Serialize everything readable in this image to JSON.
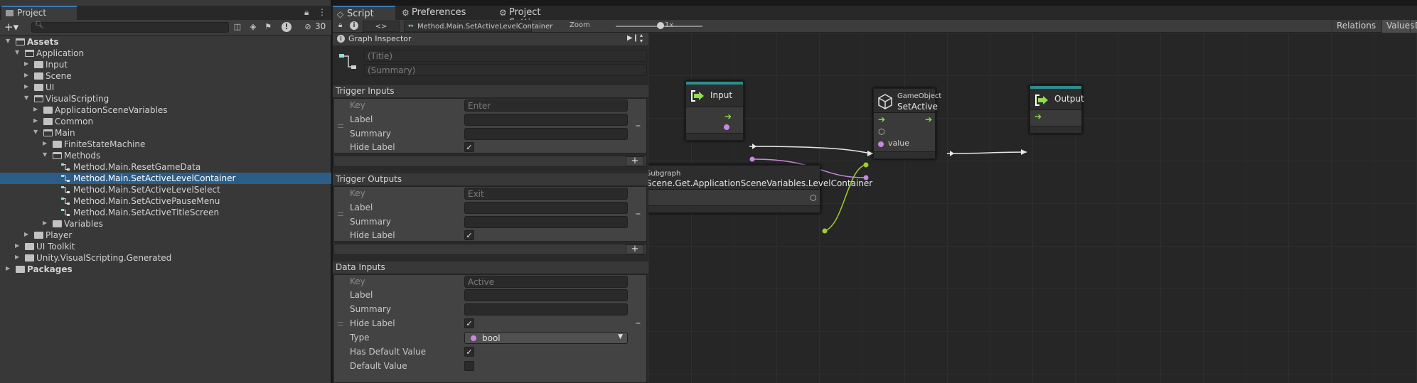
{
  "project": {
    "tab_label": "Project",
    "hidden_count": "30",
    "search": {
      "placeholder": ""
    },
    "tree": [
      {
        "label": "Assets",
        "bold": true
      },
      {
        "label": "Application"
      },
      {
        "label": "Input"
      },
      {
        "label": "Scene"
      },
      {
        "label": "UI"
      },
      {
        "label": "VisualScripting"
      },
      {
        "label": "ApplicationSceneVariables"
      },
      {
        "label": "Common"
      },
      {
        "label": "Main"
      },
      {
        "label": "FiniteStateMachine"
      },
      {
        "label": "Methods"
      },
      {
        "label": "Method.Main.ResetGameData"
      },
      {
        "label": "Method.Main.SetActiveLevelContainer",
        "selected": true
      },
      {
        "label": "Method.Main.SetActiveLevelSelect"
      },
      {
        "label": "Method.Main.SetActivePauseMenu"
      },
      {
        "label": "Method.Main.SetActiveTitleScreen"
      },
      {
        "label": "Variables"
      },
      {
        "label": "Player"
      },
      {
        "label": "UI Toolkit"
      },
      {
        "label": "Unity.VisualScripting.Generated"
      },
      {
        "label": "Packages",
        "bold": true
      }
    ]
  },
  "graph": {
    "tabs": [
      "Script Graph",
      "Preferences",
      "Project Settings"
    ],
    "toolbar": {
      "breadcrumb": "Method.Main.SetActiveLevelContainer",
      "zoom_label": "Zoom",
      "zoom_value": "1x",
      "zoom_level": 0.5,
      "right_tabs": [
        "Relations",
        "Values",
        "D"
      ]
    }
  },
  "inspector": {
    "title": "Graph Inspector",
    "title_placeholder": "(Title)",
    "summary_placeholder": "(Summary)",
    "trigger_inputs": {
      "header": "Trigger Inputs",
      "key_label": "Key",
      "key_value": "Enter",
      "label_label": "Label",
      "summary_label": "Summary",
      "hide_label": "Hide Label",
      "hide_checked": true
    },
    "trigger_outputs": {
      "header": "Trigger Outputs",
      "key_label": "Key",
      "key_value": "Exit",
      "label_label": "Label",
      "summary_label": "Summary",
      "hide_label": "Hide Label",
      "hide_checked": true
    },
    "data_inputs": {
      "header": "Data Inputs",
      "key_label": "Key",
      "key_value": "Active",
      "label_label": "Label",
      "summary_label": "Summary",
      "hide_label": "Hide Label",
      "hide_checked": true,
      "type_label": "Type",
      "type_value": "bool",
      "has_default_label": "Has Default Value",
      "has_default_checked": true,
      "default_label": "Default Value",
      "default_checked": false
    }
  },
  "nodes": {
    "input": {
      "title": "Input"
    },
    "setactive": {
      "subtitle": "GameObject",
      "title": "SetActive",
      "port_value": "value"
    },
    "output": {
      "title": "Output"
    },
    "subgraph": {
      "subtitle": "Subgraph",
      "title": "Scene.Get.ApplicationSceneVariables.LevelContainer"
    }
  },
  "colors": {
    "control": "#8ee04a",
    "bool_port": "#c788e0",
    "gameobject_port": "#9fcf2c",
    "selection": "#2c5d87",
    "node_header_accent": "#2f8c8c"
  }
}
